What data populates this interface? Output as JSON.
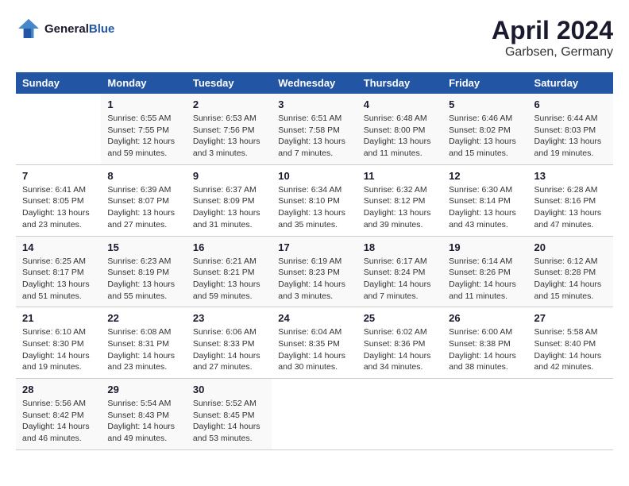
{
  "header": {
    "logo_line1": "General",
    "logo_line2": "Blue",
    "month": "April 2024",
    "location": "Garbsen, Germany"
  },
  "days_of_week": [
    "Sunday",
    "Monday",
    "Tuesday",
    "Wednesday",
    "Thursday",
    "Friday",
    "Saturday"
  ],
  "weeks": [
    [
      {
        "day": "",
        "info": ""
      },
      {
        "day": "1",
        "info": "Sunrise: 6:55 AM\nSunset: 7:55 PM\nDaylight: 12 hours\nand 59 minutes."
      },
      {
        "day": "2",
        "info": "Sunrise: 6:53 AM\nSunset: 7:56 PM\nDaylight: 13 hours\nand 3 minutes."
      },
      {
        "day": "3",
        "info": "Sunrise: 6:51 AM\nSunset: 7:58 PM\nDaylight: 13 hours\nand 7 minutes."
      },
      {
        "day": "4",
        "info": "Sunrise: 6:48 AM\nSunset: 8:00 PM\nDaylight: 13 hours\nand 11 minutes."
      },
      {
        "day": "5",
        "info": "Sunrise: 6:46 AM\nSunset: 8:02 PM\nDaylight: 13 hours\nand 15 minutes."
      },
      {
        "day": "6",
        "info": "Sunrise: 6:44 AM\nSunset: 8:03 PM\nDaylight: 13 hours\nand 19 minutes."
      }
    ],
    [
      {
        "day": "7",
        "info": "Sunrise: 6:41 AM\nSunset: 8:05 PM\nDaylight: 13 hours\nand 23 minutes."
      },
      {
        "day": "8",
        "info": "Sunrise: 6:39 AM\nSunset: 8:07 PM\nDaylight: 13 hours\nand 27 minutes."
      },
      {
        "day": "9",
        "info": "Sunrise: 6:37 AM\nSunset: 8:09 PM\nDaylight: 13 hours\nand 31 minutes."
      },
      {
        "day": "10",
        "info": "Sunrise: 6:34 AM\nSunset: 8:10 PM\nDaylight: 13 hours\nand 35 minutes."
      },
      {
        "day": "11",
        "info": "Sunrise: 6:32 AM\nSunset: 8:12 PM\nDaylight: 13 hours\nand 39 minutes."
      },
      {
        "day": "12",
        "info": "Sunrise: 6:30 AM\nSunset: 8:14 PM\nDaylight: 13 hours\nand 43 minutes."
      },
      {
        "day": "13",
        "info": "Sunrise: 6:28 AM\nSunset: 8:16 PM\nDaylight: 13 hours\nand 47 minutes."
      }
    ],
    [
      {
        "day": "14",
        "info": "Sunrise: 6:25 AM\nSunset: 8:17 PM\nDaylight: 13 hours\nand 51 minutes."
      },
      {
        "day": "15",
        "info": "Sunrise: 6:23 AM\nSunset: 8:19 PM\nDaylight: 13 hours\nand 55 minutes."
      },
      {
        "day": "16",
        "info": "Sunrise: 6:21 AM\nSunset: 8:21 PM\nDaylight: 13 hours\nand 59 minutes."
      },
      {
        "day": "17",
        "info": "Sunrise: 6:19 AM\nSunset: 8:23 PM\nDaylight: 14 hours\nand 3 minutes."
      },
      {
        "day": "18",
        "info": "Sunrise: 6:17 AM\nSunset: 8:24 PM\nDaylight: 14 hours\nand 7 minutes."
      },
      {
        "day": "19",
        "info": "Sunrise: 6:14 AM\nSunset: 8:26 PM\nDaylight: 14 hours\nand 11 minutes."
      },
      {
        "day": "20",
        "info": "Sunrise: 6:12 AM\nSunset: 8:28 PM\nDaylight: 14 hours\nand 15 minutes."
      }
    ],
    [
      {
        "day": "21",
        "info": "Sunrise: 6:10 AM\nSunset: 8:30 PM\nDaylight: 14 hours\nand 19 minutes."
      },
      {
        "day": "22",
        "info": "Sunrise: 6:08 AM\nSunset: 8:31 PM\nDaylight: 14 hours\nand 23 minutes."
      },
      {
        "day": "23",
        "info": "Sunrise: 6:06 AM\nSunset: 8:33 PM\nDaylight: 14 hours\nand 27 minutes."
      },
      {
        "day": "24",
        "info": "Sunrise: 6:04 AM\nSunset: 8:35 PM\nDaylight: 14 hours\nand 30 minutes."
      },
      {
        "day": "25",
        "info": "Sunrise: 6:02 AM\nSunset: 8:36 PM\nDaylight: 14 hours\nand 34 minutes."
      },
      {
        "day": "26",
        "info": "Sunrise: 6:00 AM\nSunset: 8:38 PM\nDaylight: 14 hours\nand 38 minutes."
      },
      {
        "day": "27",
        "info": "Sunrise: 5:58 AM\nSunset: 8:40 PM\nDaylight: 14 hours\nand 42 minutes."
      }
    ],
    [
      {
        "day": "28",
        "info": "Sunrise: 5:56 AM\nSunset: 8:42 PM\nDaylight: 14 hours\nand 46 minutes."
      },
      {
        "day": "29",
        "info": "Sunrise: 5:54 AM\nSunset: 8:43 PM\nDaylight: 14 hours\nand 49 minutes."
      },
      {
        "day": "30",
        "info": "Sunrise: 5:52 AM\nSunset: 8:45 PM\nDaylight: 14 hours\nand 53 minutes."
      },
      {
        "day": "",
        "info": ""
      },
      {
        "day": "",
        "info": ""
      },
      {
        "day": "",
        "info": ""
      },
      {
        "day": "",
        "info": ""
      }
    ]
  ]
}
